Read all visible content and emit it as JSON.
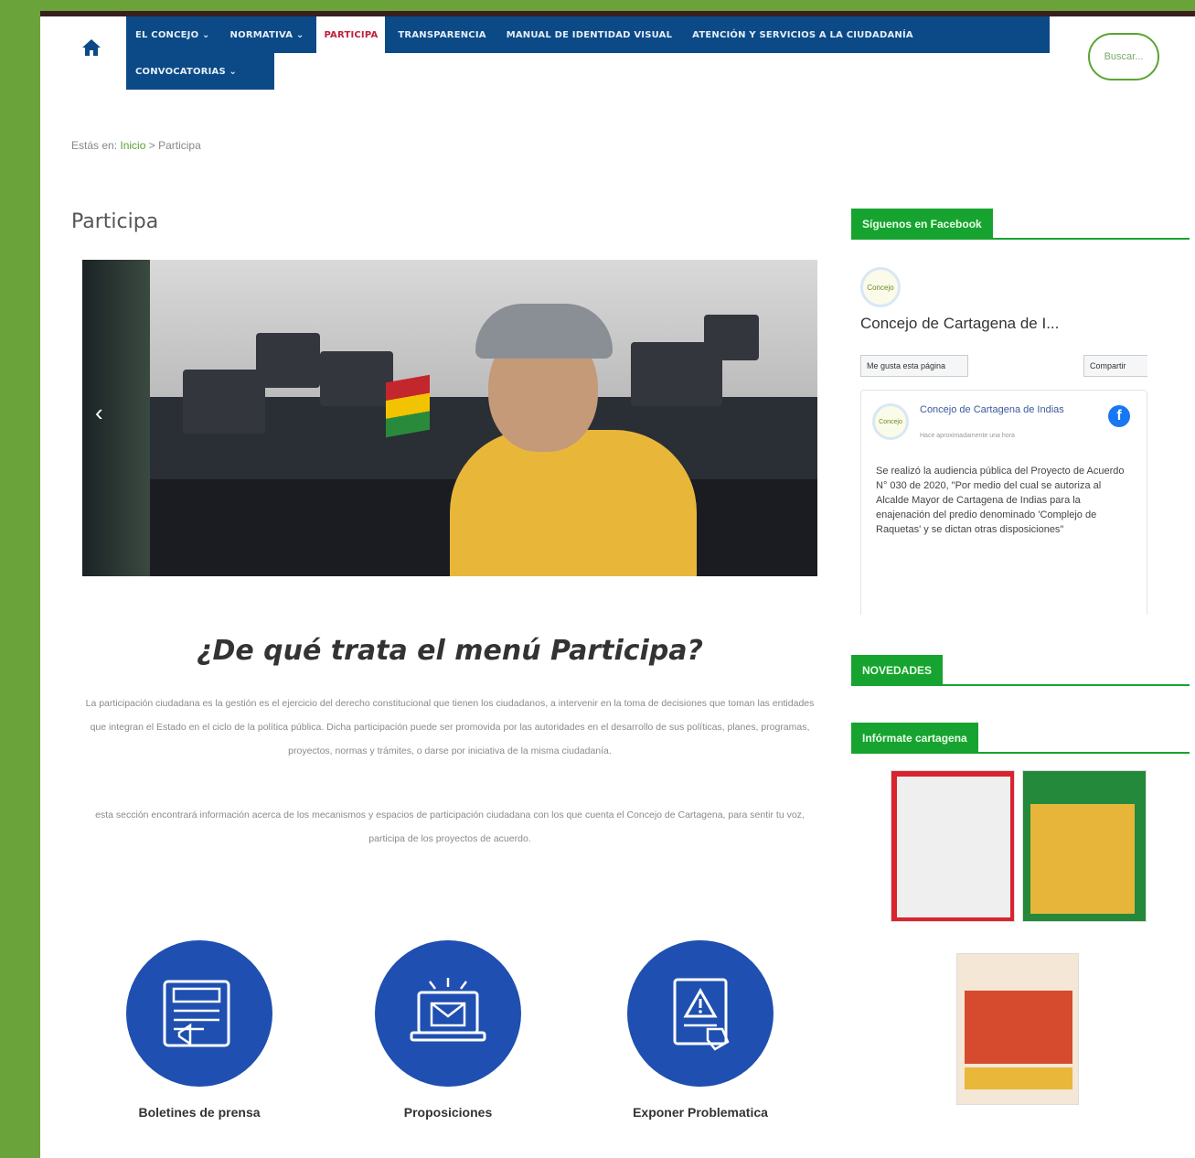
{
  "nav": {
    "items": [
      "EL CONCEJO ⌄",
      "NORMATIVA ⌄",
      "PARTICIPA",
      "TRANSPARENCIA",
      "MANUAL DE IDENTIDAD VISUAL",
      "ATENCIÓN Y SERVICIOS A LA CIUDADANÍA"
    ],
    "second_row": "CONVOCATORIAS ⌄",
    "search_label": "Buscar..."
  },
  "breadcrumb": {
    "prefix": "Estás en:",
    "home": "Inicio",
    "separator": ">",
    "current": "Participa"
  },
  "page": {
    "title": "Participa",
    "section_title": "¿De qué trata el menú Participa?",
    "paragraph_1": "La participación ciudadana es la gestión es el ejercicio del derecho constitucional que tienen los ciudadanos, a intervenir en la toma de decisiones que toman las entidades que integran el Estado en el ciclo de la política pública. Dicha participación puede ser promovida por las autoridades en el desarrollo de sus políticas, planes, programas, proyectos, normas y trámites, o darse por iniciativa de la misma ciudadanía.",
    "paragraph_2": "esta sección encontrará información acerca de los mecanismos y espacios de participación ciudadana con los que cuenta el Concejo de Cartagena, para sentir tu voz, participa de los proyectos de acuerdo.",
    "hero_prev": "‹"
  },
  "features": [
    {
      "label": "Boletines de prensa",
      "icon": "newspaper-icon"
    },
    {
      "label": "Proposiciones",
      "icon": "email-laptop-icon"
    },
    {
      "label": "Exponer Problematica",
      "icon": "warning-document-icon"
    }
  ],
  "sidebar": {
    "facebook_heading": "Síguenos en Facebook",
    "novedades_heading": "NOVEDADES",
    "informate_heading": "Infórmate cartagena",
    "fb_page_name": "Concejo de Cartagena de I...",
    "fb_like": "Me gusta esta página",
    "fb_share": "Compartir",
    "fb_post_title": "Concejo de Cartagena de Indias",
    "fb_post_sub": "Hace aproximadamente una hora",
    "fb_post_text": "Se realizó la audiencia pública del Proyecto de Acuerdo N° 030 de 2020, \"Por medio del cual se autoriza al Alcalde Mayor de Cartagena de Indias para la enajenación del predio denominado 'Complejo de Raquetas' y se dictan otras disposiciones\"",
    "fb_logo_text": "Concejo"
  }
}
